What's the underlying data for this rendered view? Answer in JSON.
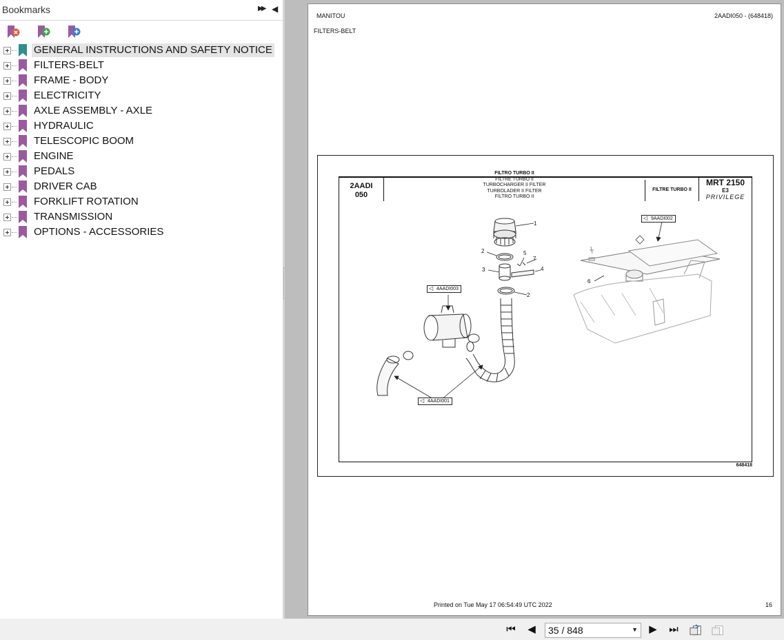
{
  "bookmarks_panel": {
    "title": "Bookmarks",
    "items": [
      {
        "label": "GENERAL INSTRUCTIONS AND SAFETY NOTICE",
        "selected": true
      },
      {
        "label": "FILTERS-BELT"
      },
      {
        "label": "FRAME - BODY"
      },
      {
        "label": "ELECTRICITY"
      },
      {
        "label": "AXLE ASSEMBLY - AXLE"
      },
      {
        "label": "HYDRAULIC"
      },
      {
        "label": "TELESCOPIC BOOM"
      },
      {
        "label": "ENGINE"
      },
      {
        "label": "PEDALS"
      },
      {
        "label": "DRIVER CAB"
      },
      {
        "label": "FORKLIFT ROTATION"
      },
      {
        "label": "TRANSMISSION"
      },
      {
        "label": "OPTIONS - ACCESSORIES"
      }
    ],
    "icons": [
      "expand-panel-icon",
      "collapse-panel-icon",
      "delete-bookmark-icon",
      "add-bookmark-icon",
      "add-child-bookmark-icon"
    ]
  },
  "page": {
    "brand": "MANITOU",
    "section": "FILTERS-BELT",
    "reference": "2AADI050 - (648418)",
    "printed": "Printed on  Tue May 17 06:54:49 UTC 2022",
    "page_number": "16",
    "figure": {
      "code_line1": "2AADI",
      "code_line2": "050",
      "titles": [
        "FILTRO TURBO II",
        "FILTRE TURBO II",
        "TURBOCHARGER II  FILTER",
        "TURBOLADER II  FILTER",
        "FILTRO TURBO II"
      ],
      "ref_title": "FILTRE TURBO II",
      "model": "MRT 2150",
      "model_sub": "E3",
      "model_brand": "PRIVILEGE",
      "figure_id": "648418",
      "callouts": [
        "4AADI003",
        "4AADI001",
        "9AADI002"
      ],
      "part_numbers": [
        "1",
        "2",
        "3",
        "4",
        "5",
        "7",
        "2",
        "6"
      ]
    }
  },
  "navigation": {
    "page_field": "35 / 848",
    "icons": [
      "first-page-icon",
      "previous-page-icon",
      "next-page-icon",
      "last-page-icon",
      "previous-view-icon",
      "next-view-icon"
    ]
  },
  "colors": {
    "bookmark_selected": "#2f8f8c",
    "bookmark": "#9b5aa0",
    "viewer_background": "#bdbdbd"
  }
}
